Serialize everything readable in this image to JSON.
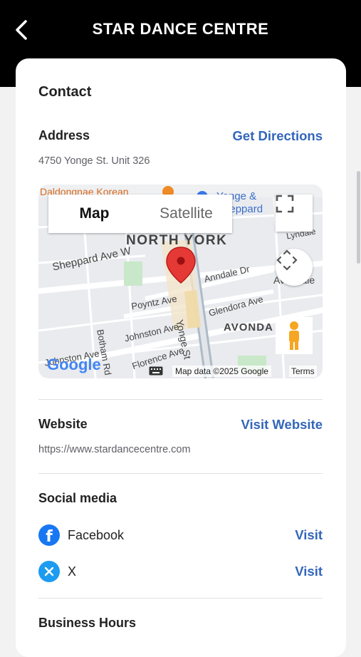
{
  "header": {
    "title": "STAR DANCE CENTRE"
  },
  "contact": {
    "title": "Contact",
    "address": {
      "label": "Address",
      "action": "Get Directions",
      "value": "4750 Yonge St. Unit 326"
    },
    "map": {
      "tab_map": "Map",
      "tab_satellite": "Satellite",
      "attribution": "Map data ©2025 Google",
      "terms": "Terms",
      "logo": "Google",
      "labels": {
        "north_york": "NORTH YORK",
        "sheppard": "Sheppard Ave W",
        "poyntz": "Poyntz Ave",
        "johnston": "Johnston Ave",
        "yonge": "Yonge St",
        "annedale": "Anndale Dr",
        "glendora": "Glendora Ave",
        "avonda": "AVONDA",
        "florence": "Florence Ave",
        "bothan": "Botham Rd",
        "johnston2": "Johnston Ave",
        "avondale2": "Avondale",
        "lyndale": "Lyndale",
        "restaurant": "Daldongnae Korean",
        "station": "Yonge & Sheppard"
      }
    },
    "website": {
      "label": "Website",
      "action": "Visit Website",
      "value": "https://www.stardancecentre.com"
    },
    "social": {
      "label": "Social media",
      "items": [
        {
          "name": "Facebook",
          "action": "Visit"
        },
        {
          "name": "X",
          "action": "Visit"
        }
      ]
    },
    "hours": {
      "label": "Business Hours"
    }
  },
  "colors": {
    "link": "#3366bb",
    "facebook": "#1877f2",
    "x": "#1d9bf0",
    "map_pin": "#e53935"
  }
}
